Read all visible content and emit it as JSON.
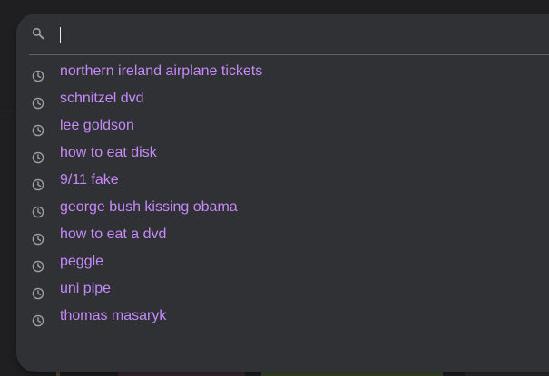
{
  "search": {
    "value": "",
    "icon": "search-icon"
  },
  "suggestions": [
    {
      "label": "northern ireland airplane tickets",
      "icon": "history-icon"
    },
    {
      "label": "schnitzel dvd",
      "icon": "history-icon"
    },
    {
      "label": "lee goldson",
      "icon": "history-icon"
    },
    {
      "label": "how to eat disk",
      "icon": "history-icon"
    },
    {
      "label": "9/11 fake",
      "icon": "history-icon"
    },
    {
      "label": "george bush kissing obama",
      "icon": "history-icon"
    },
    {
      "label": "how to eat a dvd",
      "icon": "history-icon"
    },
    {
      "label": "peggle",
      "icon": "history-icon"
    },
    {
      "label": "uni pipe",
      "icon": "history-icon"
    },
    {
      "label": "thomas masaryk",
      "icon": "history-icon"
    }
  ],
  "colors": {
    "background": "#1f1f21",
    "dropdown": "#303134",
    "visited_link": "#c58af9",
    "icon": "#9aa0a6",
    "divider": "#5f6368"
  }
}
